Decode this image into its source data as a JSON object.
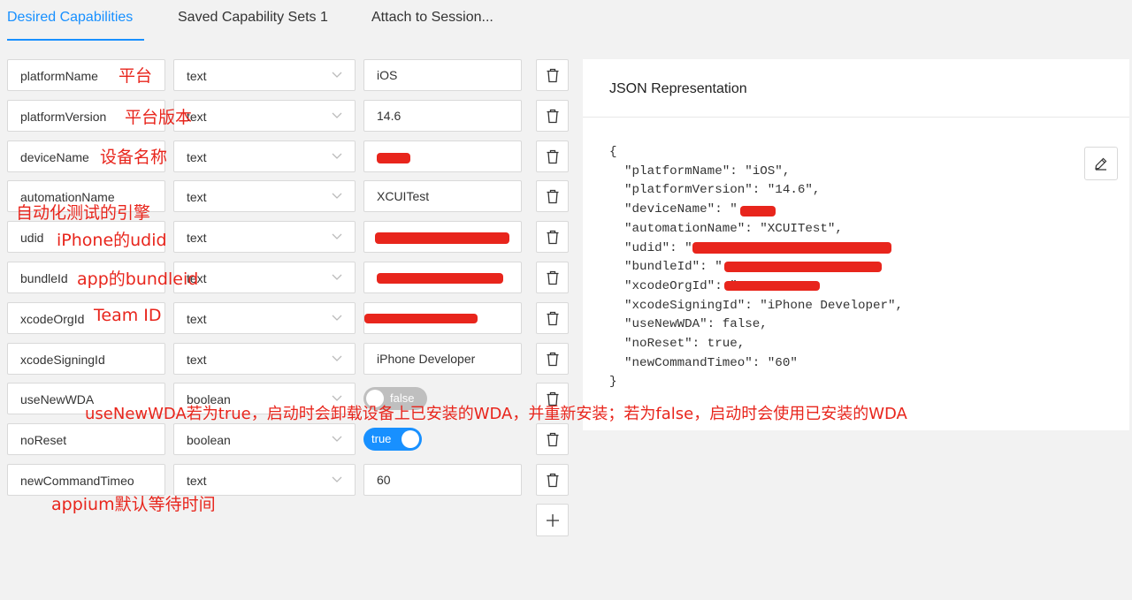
{
  "tabs": [
    {
      "label": "Desired Capabilities"
    },
    {
      "label": "Saved Capability Sets 1"
    },
    {
      "label": "Attach to Session..."
    }
  ],
  "capabilities": [
    {
      "name": "platformName",
      "type": "text",
      "value": "iOS"
    },
    {
      "name": "platformVersion",
      "type": "text",
      "value": "14.6"
    },
    {
      "name": "deviceName",
      "type": "text",
      "value": ""
    },
    {
      "name": "automationName",
      "type": "text",
      "value": "XCUITest"
    },
    {
      "name": "udid",
      "type": "text",
      "value": ""
    },
    {
      "name": "bundleId",
      "type": "text",
      "value": ""
    },
    {
      "name": "xcodeOrgId",
      "type": "text",
      "value": ""
    },
    {
      "name": "xcodeSigningId",
      "type": "text",
      "value": "iPhone Developer"
    },
    {
      "name": "useNewWDA",
      "type": "boolean",
      "value": "false"
    },
    {
      "name": "noReset",
      "type": "boolean",
      "value": "true"
    },
    {
      "name": "newCommandTimeo",
      "type": "text",
      "value": "60"
    }
  ],
  "json_panel": {
    "title": "JSON Representation",
    "lines": [
      "{",
      "  \"platformName\": \"iOS\",",
      "  \"platformVersion\": \"14.6\",",
      "  \"deviceName\": \"",
      "  \"automationName\": \"XCUITest\",",
      "  \"udid\": \"",
      "  \"bundleId\": \"",
      "  \"xcodeOrgId\": \"",
      "  \"xcodeSigningId\": \"iPhone Developer\",",
      "  \"useNewWDA\": false,",
      "  \"noReset\": true,",
      "  \"newCommandTimeo\": \"60\"",
      "}"
    ]
  },
  "annotations": {
    "platformName": "平台",
    "platformVersion": "平台版本",
    "deviceName": "设备名称",
    "automationName": "自动化测试的引擎",
    "udid": "iPhone的udid",
    "bundleId": "app的bundleid",
    "xcodeOrgId": "Team ID",
    "useNewWDA": "useNewWDA若为true，启动时会卸载设备上已安装的WDA，并重新安装；若为false，启动时会使用已安装的WDA",
    "newCommandTimeout": "appium默认等待时间"
  },
  "colors": {
    "accent": "#1890ff",
    "annotation": "#e8251c",
    "background": "#f2f2f2"
  },
  "icons": {
    "delete": "trash-icon",
    "add": "plus-icon",
    "edit": "pencil-icon",
    "dropdown": "chevron-down-icon"
  }
}
